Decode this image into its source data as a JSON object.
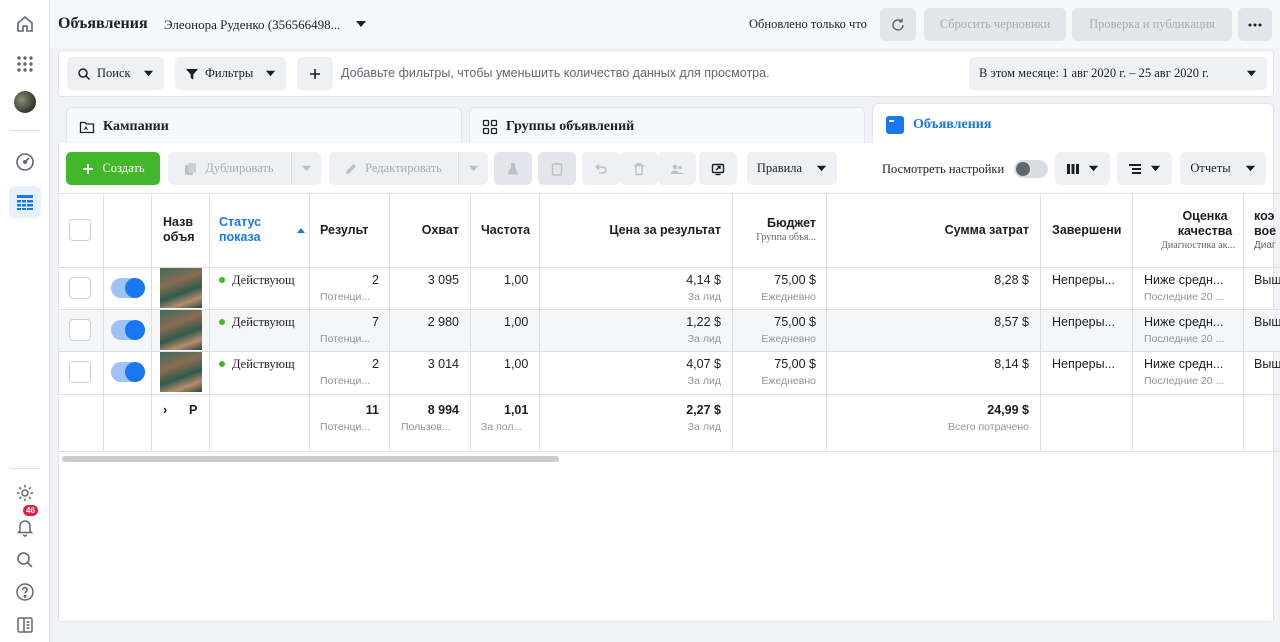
{
  "header": {
    "title": "Объявления",
    "account": "Элеонора Руденко (356566498...",
    "updated": "Обновлено только что",
    "reset_drafts": "Сбросить черновики",
    "review_publish": "Проверка и публикация"
  },
  "rail": {
    "notification_count": "46"
  },
  "filterbar": {
    "search": "Поиск",
    "filters": "Фильтры",
    "hint": "Добавьте фильтры, чтобы уменьшить количество данных для просмотра.",
    "date_range": "В этом месяце: 1 авг 2020 г. – 25 авг 2020 г."
  },
  "tabs": [
    {
      "label": "Кампании"
    },
    {
      "label": "Группы объявлений"
    },
    {
      "label": "Объявления"
    }
  ],
  "toolbar": {
    "create": "Создать",
    "duplicate": "Дублировать",
    "edit": "Редактировать",
    "rules": "Правила",
    "view_settings": "Посмотреть настройки",
    "reports": "Отчеты"
  },
  "columns": {
    "name": "Назв объя",
    "status": "Статус показа",
    "results": "Результ",
    "reach": "Охват",
    "frequency": "Частота",
    "cost_per_result": "Цена за результат",
    "budget": "Бюджет",
    "budget_sub": "Группа объя...",
    "amount_spent": "Сумма затрат",
    "ends": "Завершени",
    "quality": "Оценка качества",
    "quality_sub": "Диагностика ак...",
    "next": "коэ вое",
    "next_sub": "Диаг"
  },
  "rows": [
    {
      "status": "Действующ",
      "results": "2",
      "results_sub": "Потенци...",
      "reach": "3 095",
      "frequency": "1,00",
      "cpr": "4,14 $",
      "cpr_sub": "За лид",
      "budget": "75,00 $",
      "budget_sub": "Ежедневно",
      "spent": "8,28 $",
      "ends": "Непреры...",
      "quality": "Ниже средн...",
      "quality_sub": "Последние 20 ...",
      "next": "Выш"
    },
    {
      "status": "Действующ",
      "results": "7",
      "results_sub": "Потенци...",
      "reach": "2 980",
      "frequency": "1,00",
      "cpr": "1,22 $",
      "cpr_sub": "За лид",
      "budget": "75,00 $",
      "budget_sub": "Ежедневно",
      "spent": "8,57 $",
      "ends": "Непреры...",
      "quality": "Ниже средн...",
      "quality_sub": "Последние 20 ...",
      "next": "Выш"
    },
    {
      "status": "Действующ",
      "results": "2",
      "results_sub": "Потенци...",
      "reach": "3 014",
      "frequency": "1,00",
      "cpr": "4,07 $",
      "cpr_sub": "За лид",
      "budget": "75,00 $",
      "budget_sub": "Ежедневно",
      "spent": "8,14 $",
      "ends": "Непреры...",
      "quality": "Ниже средн...",
      "quality_sub": "Последние 20 ...",
      "next": "Выш"
    }
  ],
  "totals": {
    "label": "Р",
    "results": "11",
    "results_sub": "Потенци...",
    "reach": "8 994",
    "reach_sub": "Пользов...",
    "frequency": "1,01",
    "frequency_sub": "За пол...",
    "cpr": "2,27 $",
    "cpr_sub": "За лид",
    "spent": "24,99 $",
    "spent_sub": "Всего потрачено"
  }
}
